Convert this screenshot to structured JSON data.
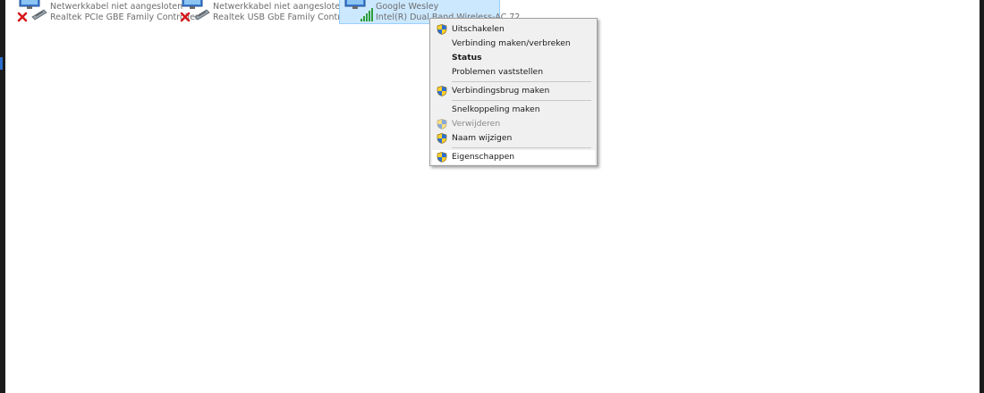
{
  "adapters": [
    {
      "status": "Netwerkkabel niet aangesloten",
      "device": "Realtek PCIe GBE Family Controller",
      "icon": "ethernet-disconnected-icon"
    },
    {
      "status": "Netwerkkabel niet aangesloten",
      "device": "Realtek USB GbE Family Controller",
      "icon": "ethernet-disconnected-icon"
    },
    {
      "status": "Google Wesley",
      "device": "Intel(R) Dual Band Wireless-AC 72",
      "icon": "wifi-adapter-icon"
    }
  ],
  "context_menu": {
    "items": [
      {
        "label": "Uitschakelen",
        "shield": true,
        "bold": false,
        "disabled": false
      },
      {
        "label": "Verbinding maken/verbreken",
        "shield": false,
        "bold": false,
        "disabled": false
      },
      {
        "label": "Status",
        "shield": false,
        "bold": true,
        "disabled": false
      },
      {
        "label": "Problemen vaststellen",
        "shield": false,
        "bold": false,
        "disabled": false
      },
      {
        "label": "Verbindingsbrug maken",
        "shield": true,
        "bold": false,
        "disabled": false
      },
      {
        "label": "Snelkoppeling maken",
        "shield": false,
        "bold": false,
        "disabled": false
      },
      {
        "label": "Verwijderen",
        "shield": true,
        "bold": false,
        "disabled": true
      },
      {
        "label": "Naam wijzigen",
        "shield": true,
        "bold": false,
        "disabled": false
      },
      {
        "label": "Eigenschappen",
        "shield": true,
        "bold": false,
        "disabled": false,
        "highlighted": true
      }
    ]
  },
  "colors": {
    "selection_bg": "#cce8ff",
    "selection_border": "#99d1ff",
    "menu_bg": "#f0f0f0",
    "disabled_text": "#8a8a8a",
    "error_red": "#d6191c",
    "signal_green": "#2e9e3a"
  }
}
